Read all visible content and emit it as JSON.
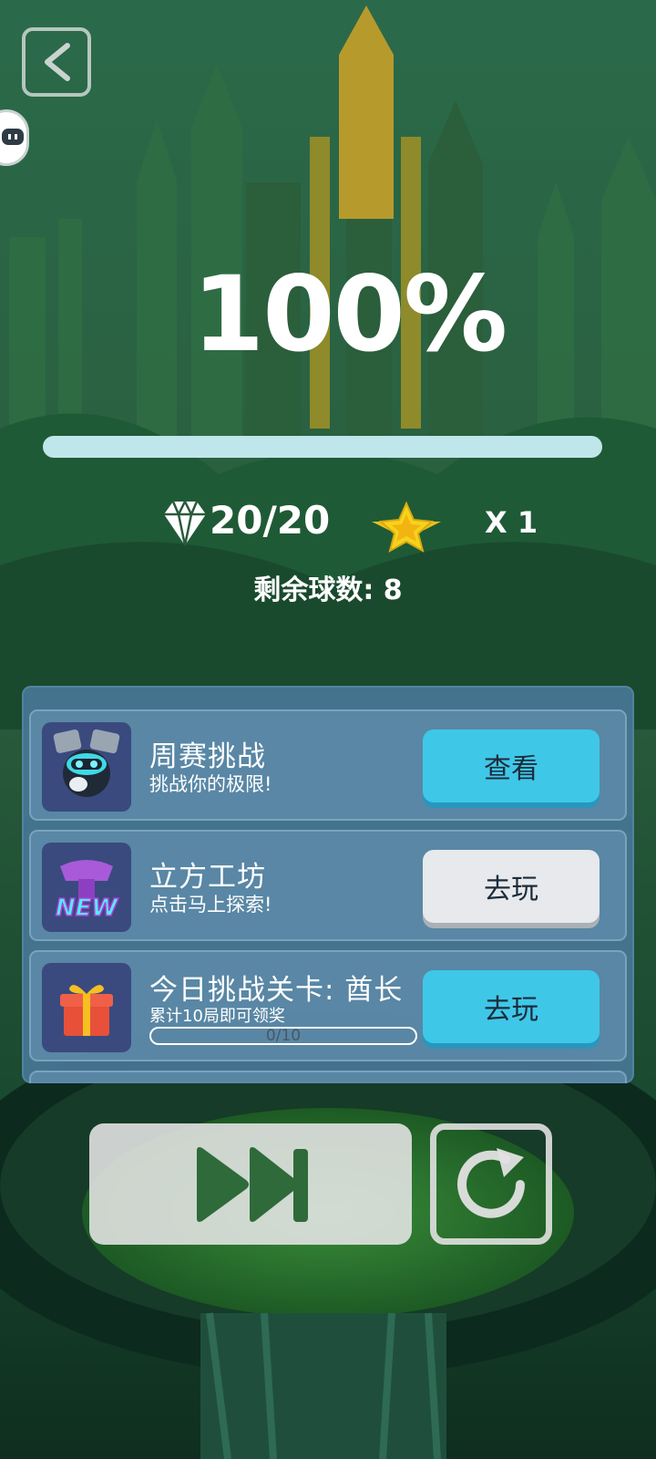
{
  "result": {
    "percent_text": "100%",
    "progress": 1.0
  },
  "stats": {
    "gems_text": "20/20",
    "star_multiplier_text": "X 1",
    "remaining_balls_text": "剩余球数: 8"
  },
  "tasks": [
    {
      "title": "周赛挑战",
      "subtitle": "挑战你的极限!",
      "button": "查看",
      "button_style": "cyan",
      "icon": "robot-ball-icon"
    },
    {
      "title": "立方工坊",
      "subtitle": "点击马上探索!",
      "button": "去玩",
      "button_style": "gray",
      "icon": "new-workshop-icon",
      "badge": "NEW"
    },
    {
      "title": "今日挑战关卡: 酋长",
      "subtitle": "累计10局即可领奖",
      "button": "去玩",
      "button_style": "cyan",
      "icon": "gift-box-icon",
      "progress_text": "0/10",
      "progress": 0.0
    }
  ],
  "colors": {
    "accent_cyan": "#3fc7e8",
    "button_gray": "#e7e9ec",
    "panel": "#48769a",
    "skip_icon": "#2f6a3a"
  }
}
